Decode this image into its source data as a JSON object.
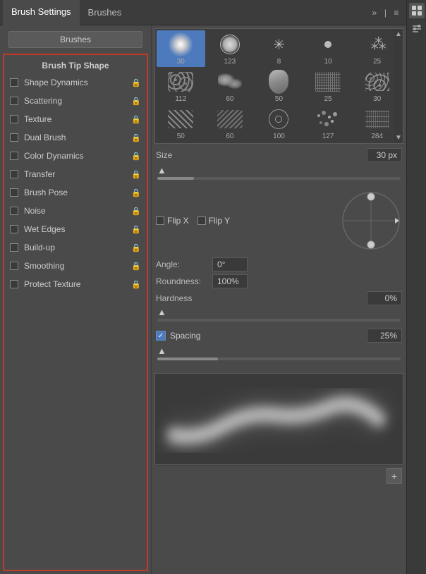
{
  "header": {
    "tab_brush_settings": "Brush Settings",
    "tab_brushes": "Brushes",
    "icon_expand": "»",
    "icon_divider": "|",
    "icon_menu": "≡"
  },
  "sidebar": {
    "brushes_button": "Brushes",
    "header_item": "Brush Tip Shape",
    "items": [
      {
        "id": "shape-dynamics",
        "label": "Shape Dynamics",
        "checked": false
      },
      {
        "id": "scattering",
        "label": "Scattering",
        "checked": false
      },
      {
        "id": "texture",
        "label": "Texture",
        "checked": false
      },
      {
        "id": "dual-brush",
        "label": "Dual Brush",
        "checked": false
      },
      {
        "id": "color-dynamics",
        "label": "Color Dynamics",
        "checked": false
      },
      {
        "id": "transfer",
        "label": "Transfer",
        "checked": false
      },
      {
        "id": "brush-pose",
        "label": "Brush Pose",
        "checked": false
      },
      {
        "id": "noise",
        "label": "Noise",
        "checked": false
      },
      {
        "id": "wet-edges",
        "label": "Wet Edges",
        "checked": false
      },
      {
        "id": "build-up",
        "label": "Build-up",
        "checked": false
      },
      {
        "id": "smoothing",
        "label": "Smoothing",
        "checked": false
      },
      {
        "id": "protect-texture",
        "label": "Protect Texture",
        "checked": false
      }
    ]
  },
  "brush_grid": {
    "brushes": [
      {
        "id": 1,
        "size": "30",
        "selected": true,
        "type": "soft-large"
      },
      {
        "id": 2,
        "size": "123",
        "selected": false,
        "type": "hard-med"
      },
      {
        "id": 3,
        "size": "8",
        "selected": false,
        "type": "star"
      },
      {
        "id": 4,
        "size": "10",
        "selected": false,
        "type": "dot"
      },
      {
        "id": 5,
        "size": "25",
        "selected": false,
        "type": "splatter"
      },
      {
        "id": 6,
        "size": "112",
        "selected": false,
        "type": "texture1"
      },
      {
        "id": 7,
        "size": "60",
        "selected": false,
        "type": "texture2"
      },
      {
        "id": 8,
        "size": "50",
        "selected": false,
        "type": "texture3"
      },
      {
        "id": 9,
        "size": "25",
        "selected": false,
        "type": "texture4"
      },
      {
        "id": 10,
        "size": "30",
        "selected": false,
        "type": "texture5"
      },
      {
        "id": 11,
        "size": "50",
        "selected": false,
        "type": "texture6"
      },
      {
        "id": 12,
        "size": "60",
        "selected": false,
        "type": "texture7"
      },
      {
        "id": 13,
        "size": "100",
        "selected": false,
        "type": "texture8"
      },
      {
        "id": 14,
        "size": "127",
        "selected": false,
        "type": "texture9"
      },
      {
        "id": 15,
        "size": "284",
        "selected": false,
        "type": "texture10"
      }
    ]
  },
  "controls": {
    "size_label": "Size",
    "size_value": "30 px",
    "flip_x_label": "Flip X",
    "flip_y_label": "Flip Y",
    "angle_label": "Angle:",
    "angle_value": "0°",
    "roundness_label": "Roundness:",
    "roundness_value": "100%",
    "hardness_label": "Hardness",
    "hardness_value": "0%",
    "spacing_label": "Spacing",
    "spacing_value": "25%",
    "spacing_checked": true
  },
  "icons": {
    "lock": "🔒",
    "expand": "»",
    "menu": "≡",
    "up_arrow": "▲",
    "down_arrow": "▼",
    "right_arrow": "▶",
    "add": "+",
    "check": "✓"
  },
  "rail_icons": [
    {
      "id": "brush-tool-icon",
      "symbol": "✎",
      "active": true
    },
    {
      "id": "settings-icon",
      "symbol": "⊞",
      "active": false
    }
  ]
}
